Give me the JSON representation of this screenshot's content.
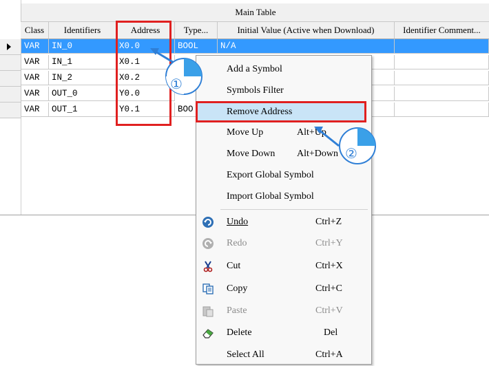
{
  "table": {
    "title": "Main Table",
    "columns": [
      "Class",
      "Identifiers",
      "Address",
      "Type...",
      "Initial Value (Active when Download)",
      "Identifier Comment..."
    ],
    "rows": [
      {
        "class": "VAR",
        "identifier": "IN_0",
        "address": "X0.0",
        "type": "BOOL",
        "initial": "N/A"
      },
      {
        "class": "VAR",
        "identifier": "IN_1",
        "address": "X0.1",
        "type": "",
        "initial": ""
      },
      {
        "class": "VAR",
        "identifier": "IN_2",
        "address": "X0.2",
        "type": "",
        "initial": ""
      },
      {
        "class": "VAR",
        "identifier": "OUT_0",
        "address": "Y0.0",
        "type": "",
        "initial": ""
      },
      {
        "class": "VAR",
        "identifier": "OUT_1",
        "address": "Y0.1",
        "type": "BOO",
        "initial": ""
      }
    ]
  },
  "menu": {
    "items": [
      {
        "label": "Add a Symbol",
        "shortcut": ""
      },
      {
        "label": "Symbols Filter",
        "shortcut": ""
      },
      {
        "label": "Remove Address",
        "shortcut": ""
      },
      {
        "label": "Move Up",
        "shortcut": "Alt+Up"
      },
      {
        "label": "Move Down",
        "shortcut": "Alt+Down"
      },
      {
        "label": "Export Global Symbol",
        "shortcut": ""
      },
      {
        "label": "Import Global Symbol",
        "shortcut": ""
      },
      {
        "label": "Undo",
        "shortcut": "Ctrl+Z",
        "icon": "undo-icon"
      },
      {
        "label": "Redo",
        "shortcut": "Ctrl+Y",
        "icon": "redo-icon",
        "disabled": true
      },
      {
        "label": "Cut",
        "shortcut": "Ctrl+X",
        "icon": "scissors-icon"
      },
      {
        "label": "Copy",
        "shortcut": "Ctrl+C",
        "icon": "copy-icon"
      },
      {
        "label": "Paste",
        "shortcut": "Ctrl+V",
        "icon": "paste-icon",
        "disabled": true
      },
      {
        "label": "Delete",
        "shortcut": "Del",
        "icon": "eraser-icon"
      },
      {
        "label": "Select All",
        "shortcut": "Ctrl+A"
      }
    ]
  },
  "callouts": {
    "step1": "①",
    "step2": "②"
  },
  "colors": {
    "selection": "#3399ff",
    "highlight_border": "#e02020",
    "callout": "#2f7fd6",
    "menu_hover": "#c9e4f7"
  }
}
